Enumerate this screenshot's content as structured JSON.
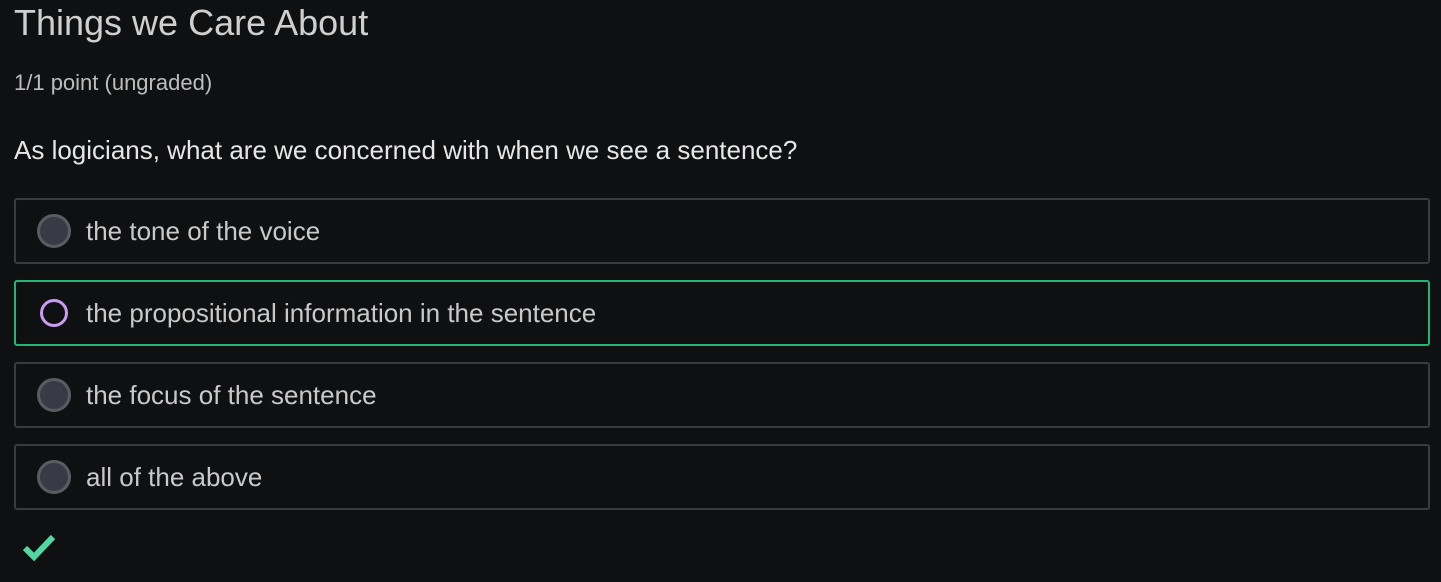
{
  "problem": {
    "title": "Things we Care About",
    "points": "1/1 point (ungraded)",
    "question": "As logicians, what are we concerned with when we see a sentence?"
  },
  "options": [
    {
      "label": "the tone of the voice",
      "selected": false
    },
    {
      "label": "the propositional information in the sentence",
      "selected": true
    },
    {
      "label": "the focus of the sentence",
      "selected": false
    },
    {
      "label": "all of the above",
      "selected": false
    }
  ],
  "status": {
    "icon": "checkmark-icon",
    "color": "#52d7a0"
  },
  "colors": {
    "background": "#0f1012",
    "selected_border": "#22b573",
    "selected_radio": "#c89cf0",
    "correct_check": "#52d7a0"
  }
}
